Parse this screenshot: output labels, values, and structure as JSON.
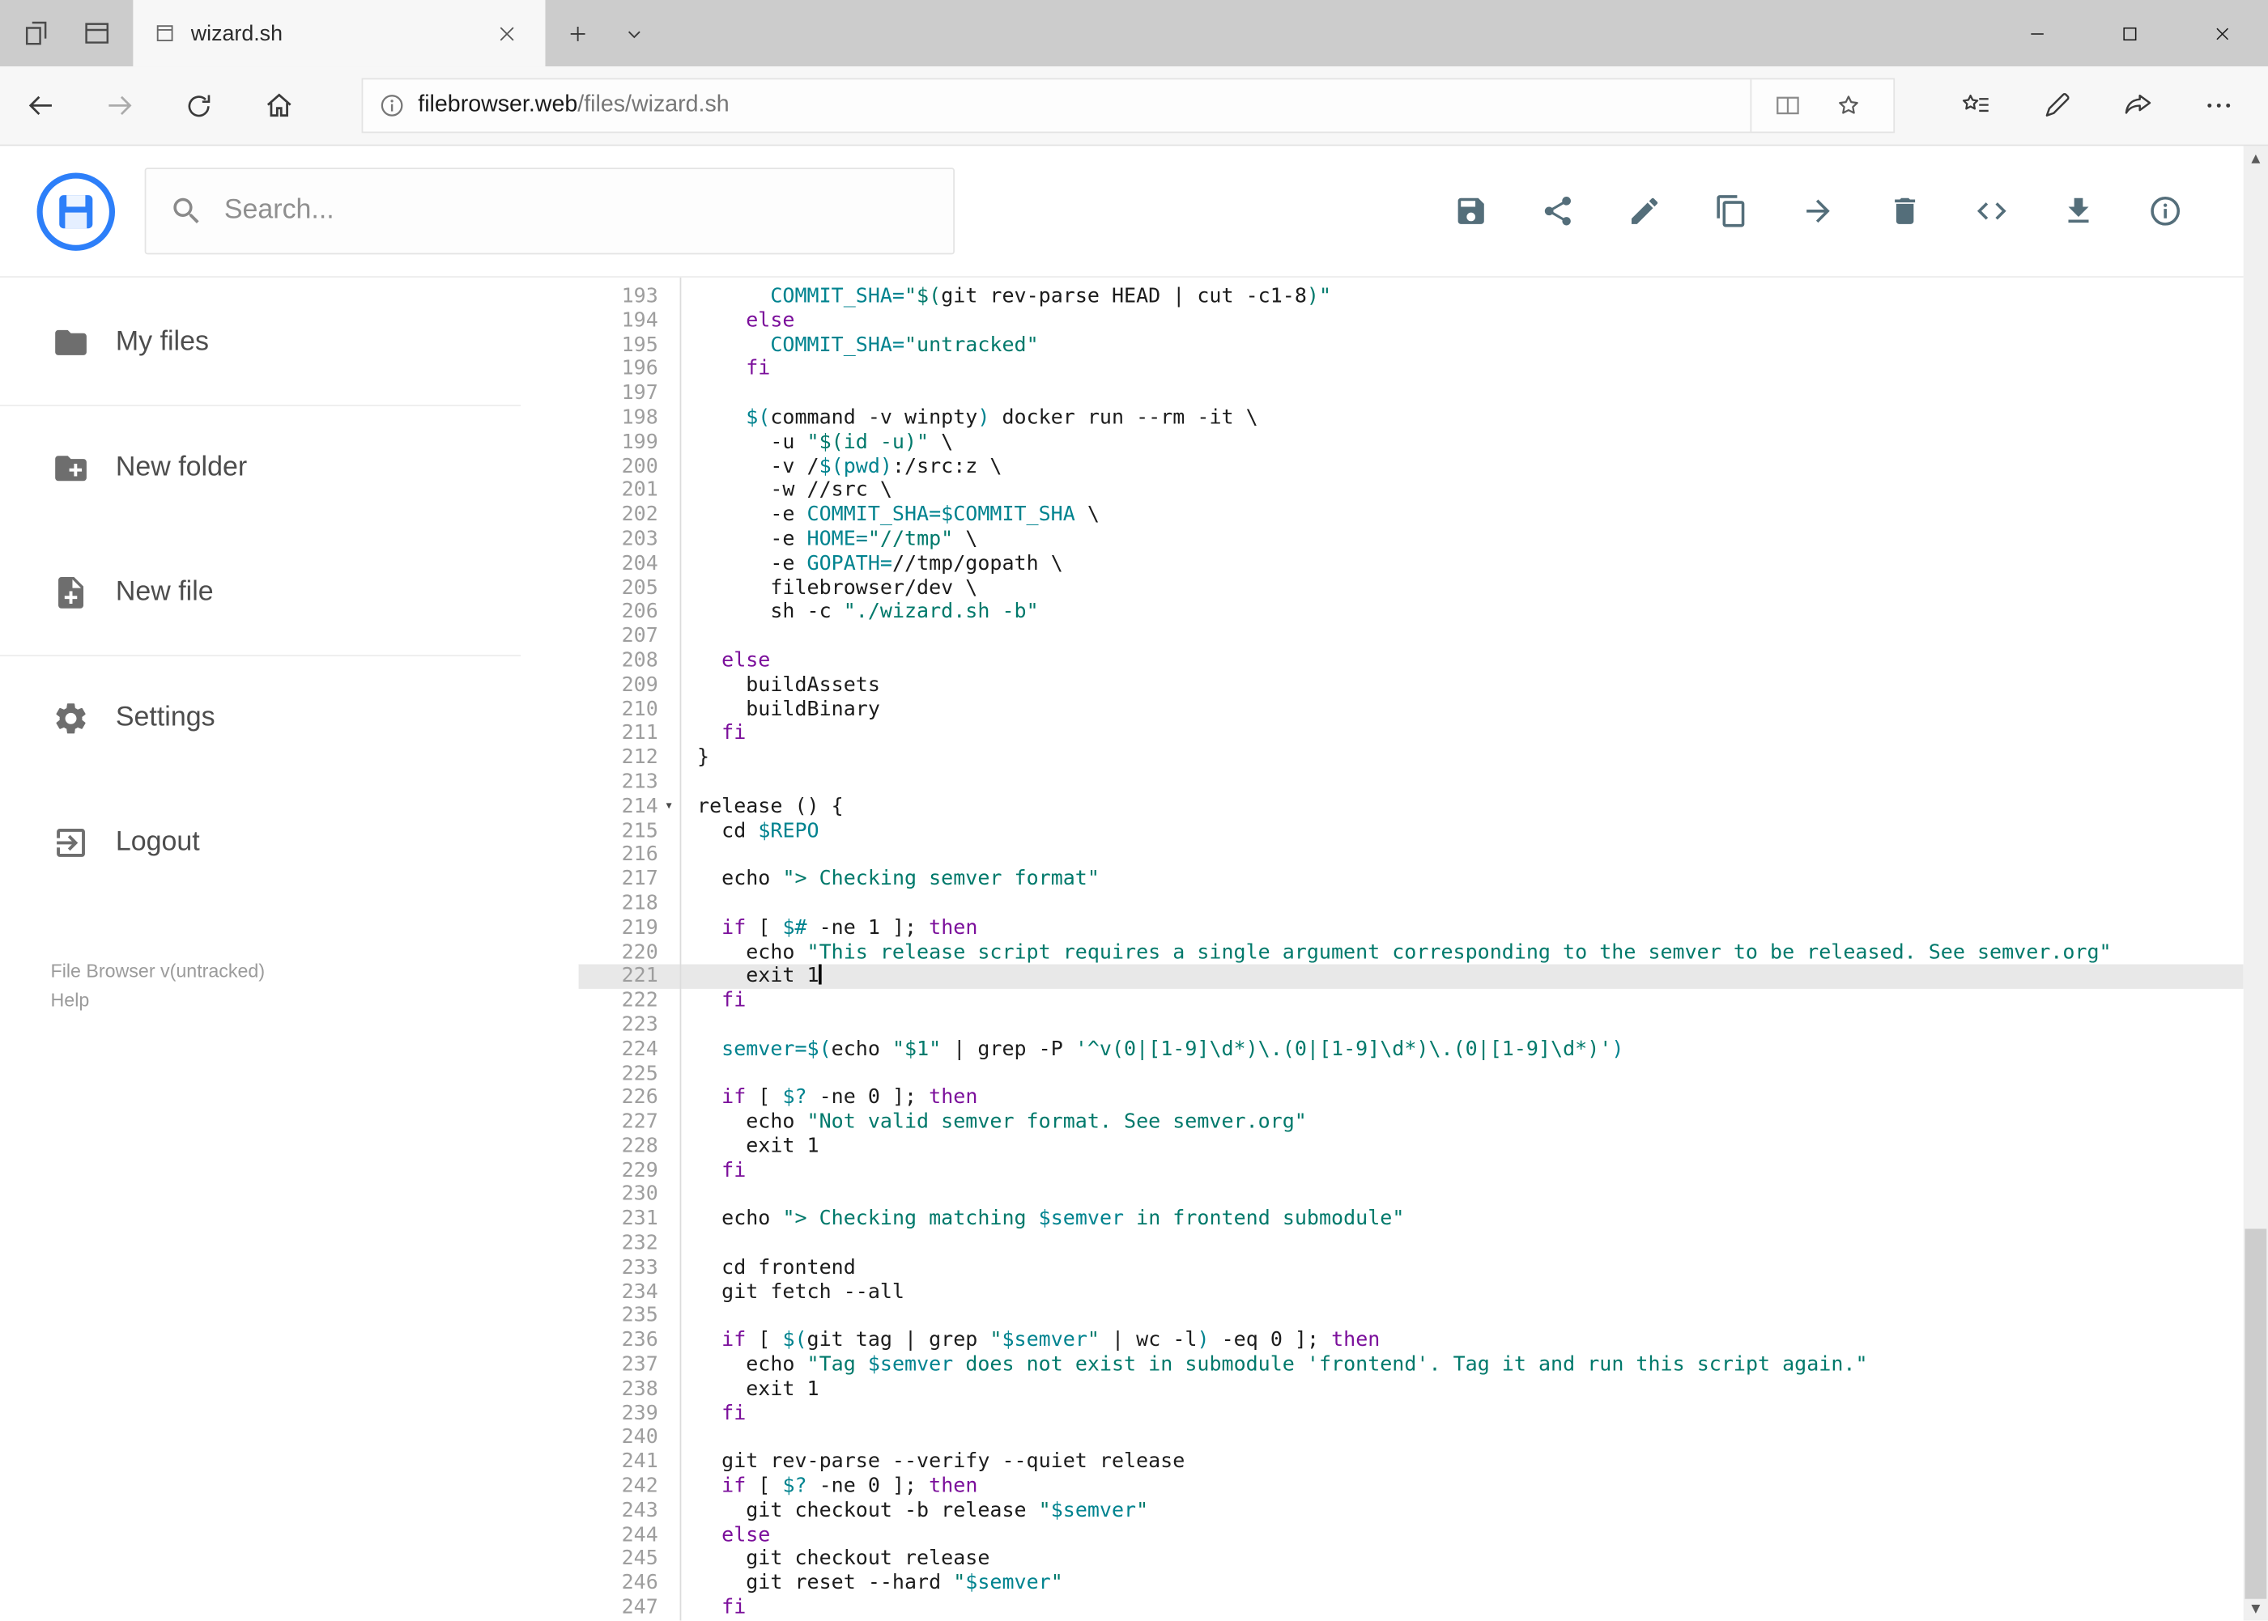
{
  "theme": {
    "accent": "#2d7ff9",
    "toolbar_icon_color": "#546e7a"
  },
  "browser": {
    "tab_title": "wizard.sh",
    "url_host": "filebrowser.web",
    "url_path": "/files/wizard.sh",
    "nav_icons": [
      "back",
      "forward",
      "refresh",
      "home"
    ],
    "address_icons": [
      "info",
      "reading-view",
      "favorite-star"
    ],
    "hub_icons": [
      "favorites-hub",
      "annotate",
      "share",
      "more"
    ],
    "window_icons": [
      "minimize",
      "maximize",
      "close"
    ]
  },
  "header": {
    "search_placeholder": "Search...",
    "action_icons": [
      "save",
      "share",
      "rename",
      "copy",
      "move",
      "delete",
      "code",
      "download",
      "info"
    ]
  },
  "sidebar": {
    "items": [
      {
        "label": "My files",
        "icon": "folder"
      },
      {
        "label": "New folder",
        "icon": "new-folder"
      },
      {
        "label": "New file",
        "icon": "new-file"
      },
      {
        "label": "Settings",
        "icon": "gear"
      },
      {
        "label": "Logout",
        "icon": "logout"
      }
    ],
    "footer": {
      "version": "File Browser v(untracked)",
      "help": "Help"
    }
  },
  "editor": {
    "active_line": 221,
    "fold_lines": [
      214
    ],
    "colors": {
      "keyword": "#7b0f9b",
      "string": "#00796b",
      "variable": "#00838f",
      "text": "#1c1c1c",
      "line_number": "#9e9e9e",
      "active_line_bg": "#e8e8e8"
    },
    "lines": [
      {
        "n": 193,
        "tokens": [
          [
            "t",
            "      "
          ],
          [
            "v",
            "COMMIT_SHA="
          ],
          [
            "s",
            "\"$("
          ],
          [
            "t",
            "git rev-parse HEAD | cut -c1-8"
          ],
          [
            "s",
            ")\""
          ]
        ]
      },
      {
        "n": 194,
        "tokens": [
          [
            "t",
            "    "
          ],
          [
            "k",
            "else"
          ]
        ]
      },
      {
        "n": 195,
        "tokens": [
          [
            "t",
            "      "
          ],
          [
            "v",
            "COMMIT_SHA="
          ],
          [
            "s",
            "\"untracked\""
          ]
        ]
      },
      {
        "n": 196,
        "tokens": [
          [
            "t",
            "    "
          ],
          [
            "k",
            "fi"
          ]
        ]
      },
      {
        "n": 197,
        "tokens": []
      },
      {
        "n": 198,
        "tokens": [
          [
            "t",
            "    "
          ],
          [
            "v",
            "$("
          ],
          [
            "t",
            "command -v winpty"
          ],
          [
            "v",
            ")"
          ],
          [
            "t",
            " docker run --rm -it \\"
          ]
        ]
      },
      {
        "n": 199,
        "tokens": [
          [
            "t",
            "      -u "
          ],
          [
            "s",
            "\"$(id -u)\""
          ],
          [
            "t",
            " \\"
          ]
        ]
      },
      {
        "n": 200,
        "tokens": [
          [
            "t",
            "      -v /"
          ],
          [
            "v",
            "$(pwd)"
          ],
          [
            "t",
            ":/src:z \\"
          ]
        ]
      },
      {
        "n": 201,
        "tokens": [
          [
            "t",
            "      -w //src \\"
          ]
        ]
      },
      {
        "n": 202,
        "tokens": [
          [
            "t",
            "      -e "
          ],
          [
            "v",
            "COMMIT_SHA=$COMMIT_SHA"
          ],
          [
            "t",
            " \\"
          ]
        ]
      },
      {
        "n": 203,
        "tokens": [
          [
            "t",
            "      -e "
          ],
          [
            "v",
            "HOME="
          ],
          [
            "s",
            "\"//tmp\""
          ],
          [
            "t",
            " \\"
          ]
        ]
      },
      {
        "n": 204,
        "tokens": [
          [
            "t",
            "      -e "
          ],
          [
            "v",
            "GOPATH="
          ],
          [
            "t",
            "//tmp/gopath \\"
          ]
        ]
      },
      {
        "n": 205,
        "tokens": [
          [
            "t",
            "      filebrowser/dev \\"
          ]
        ]
      },
      {
        "n": 206,
        "tokens": [
          [
            "t",
            "      sh -c "
          ],
          [
            "s",
            "\"./wizard.sh -b\""
          ]
        ]
      },
      {
        "n": 207,
        "tokens": []
      },
      {
        "n": 208,
        "tokens": [
          [
            "t",
            "  "
          ],
          [
            "k",
            "else"
          ]
        ]
      },
      {
        "n": 209,
        "tokens": [
          [
            "t",
            "    buildAssets"
          ]
        ]
      },
      {
        "n": 210,
        "tokens": [
          [
            "t",
            "    buildBinary"
          ]
        ]
      },
      {
        "n": 211,
        "tokens": [
          [
            "t",
            "  "
          ],
          [
            "k",
            "fi"
          ]
        ]
      },
      {
        "n": 212,
        "tokens": [
          [
            "t",
            "}"
          ]
        ]
      },
      {
        "n": 213,
        "tokens": []
      },
      {
        "n": 214,
        "tokens": [
          [
            "t",
            "release () {"
          ]
        ]
      },
      {
        "n": 215,
        "tokens": [
          [
            "t",
            "  cd "
          ],
          [
            "v",
            "$REPO"
          ]
        ]
      },
      {
        "n": 216,
        "tokens": []
      },
      {
        "n": 217,
        "tokens": [
          [
            "t",
            "  echo "
          ],
          [
            "s",
            "\"> Checking semver format\""
          ]
        ]
      },
      {
        "n": 218,
        "tokens": []
      },
      {
        "n": 219,
        "tokens": [
          [
            "t",
            "  "
          ],
          [
            "k",
            "if"
          ],
          [
            "t",
            " [ "
          ],
          [
            "v",
            "$#"
          ],
          [
            "t",
            " -ne 1 ]; "
          ],
          [
            "k",
            "then"
          ]
        ]
      },
      {
        "n": 220,
        "tokens": [
          [
            "t",
            "    echo "
          ],
          [
            "s",
            "\"This release script requires a single argument corresponding to the semver to be released. See semver.org\""
          ]
        ]
      },
      {
        "n": 221,
        "tokens": [
          [
            "t",
            "    exit 1"
          ]
        ]
      },
      {
        "n": 222,
        "tokens": [
          [
            "t",
            "  "
          ],
          [
            "k",
            "fi"
          ]
        ]
      },
      {
        "n": 223,
        "tokens": []
      },
      {
        "n": 224,
        "tokens": [
          [
            "t",
            "  "
          ],
          [
            "v",
            "semver=$("
          ],
          [
            "t",
            "echo "
          ],
          [
            "s",
            "\"$1\""
          ],
          [
            "t",
            " | grep -P "
          ],
          [
            "s",
            "'^v(0|[1-9]\\d*)\\.(0|[1-9]\\d*)\\.(0|[1-9]\\d*)'"
          ],
          [
            "v",
            ")"
          ]
        ]
      },
      {
        "n": 225,
        "tokens": []
      },
      {
        "n": 226,
        "tokens": [
          [
            "t",
            "  "
          ],
          [
            "k",
            "if"
          ],
          [
            "t",
            " [ "
          ],
          [
            "v",
            "$?"
          ],
          [
            "t",
            " -ne 0 ]; "
          ],
          [
            "k",
            "then"
          ]
        ]
      },
      {
        "n": 227,
        "tokens": [
          [
            "t",
            "    echo "
          ],
          [
            "s",
            "\"Not valid semver format. See semver.org\""
          ]
        ]
      },
      {
        "n": 228,
        "tokens": [
          [
            "t",
            "    exit 1"
          ]
        ]
      },
      {
        "n": 229,
        "tokens": [
          [
            "t",
            "  "
          ],
          [
            "k",
            "fi"
          ]
        ]
      },
      {
        "n": 230,
        "tokens": []
      },
      {
        "n": 231,
        "tokens": [
          [
            "t",
            "  echo "
          ],
          [
            "s",
            "\"> Checking matching "
          ],
          [
            "v",
            "$semver"
          ],
          [
            "s",
            " in frontend submodule\""
          ]
        ]
      },
      {
        "n": 232,
        "tokens": []
      },
      {
        "n": 233,
        "tokens": [
          [
            "t",
            "  cd frontend"
          ]
        ]
      },
      {
        "n": 234,
        "tokens": [
          [
            "t",
            "  git fetch --all"
          ]
        ]
      },
      {
        "n": 235,
        "tokens": []
      },
      {
        "n": 236,
        "tokens": [
          [
            "t",
            "  "
          ],
          [
            "k",
            "if"
          ],
          [
            "t",
            " [ "
          ],
          [
            "v",
            "$("
          ],
          [
            "t",
            "git tag | grep "
          ],
          [
            "s",
            "\""
          ],
          [
            "v",
            "$semver"
          ],
          [
            "s",
            "\""
          ],
          [
            "t",
            " | wc -l"
          ],
          [
            "v",
            ")"
          ],
          [
            "t",
            " -eq 0 ]; "
          ],
          [
            "k",
            "then"
          ]
        ]
      },
      {
        "n": 237,
        "tokens": [
          [
            "t",
            "    echo "
          ],
          [
            "s",
            "\"Tag "
          ],
          [
            "v",
            "$semver"
          ],
          [
            "s",
            " does not exist in submodule 'frontend'. Tag it and run this script again.\""
          ]
        ]
      },
      {
        "n": 238,
        "tokens": [
          [
            "t",
            "    exit 1"
          ]
        ]
      },
      {
        "n": 239,
        "tokens": [
          [
            "t",
            "  "
          ],
          [
            "k",
            "fi"
          ]
        ]
      },
      {
        "n": 240,
        "tokens": []
      },
      {
        "n": 241,
        "tokens": [
          [
            "t",
            "  git rev-parse --verify --quiet release"
          ]
        ]
      },
      {
        "n": 242,
        "tokens": [
          [
            "t",
            "  "
          ],
          [
            "k",
            "if"
          ],
          [
            "t",
            " [ "
          ],
          [
            "v",
            "$?"
          ],
          [
            "t",
            " -ne 0 ]; "
          ],
          [
            "k",
            "then"
          ]
        ]
      },
      {
        "n": 243,
        "tokens": [
          [
            "t",
            "    git checkout -b release "
          ],
          [
            "s",
            "\""
          ],
          [
            "v",
            "$semver"
          ],
          [
            "s",
            "\""
          ]
        ]
      },
      {
        "n": 244,
        "tokens": [
          [
            "t",
            "  "
          ],
          [
            "k",
            "else"
          ]
        ]
      },
      {
        "n": 245,
        "tokens": [
          [
            "t",
            "    git checkout release"
          ]
        ]
      },
      {
        "n": 246,
        "tokens": [
          [
            "t",
            "    git reset --hard "
          ],
          [
            "s",
            "\""
          ],
          [
            "v",
            "$semver"
          ],
          [
            "s",
            "\""
          ]
        ]
      },
      {
        "n": 247,
        "tokens": [
          [
            "t",
            "  "
          ],
          [
            "k",
            "fi"
          ]
        ]
      }
    ]
  }
}
